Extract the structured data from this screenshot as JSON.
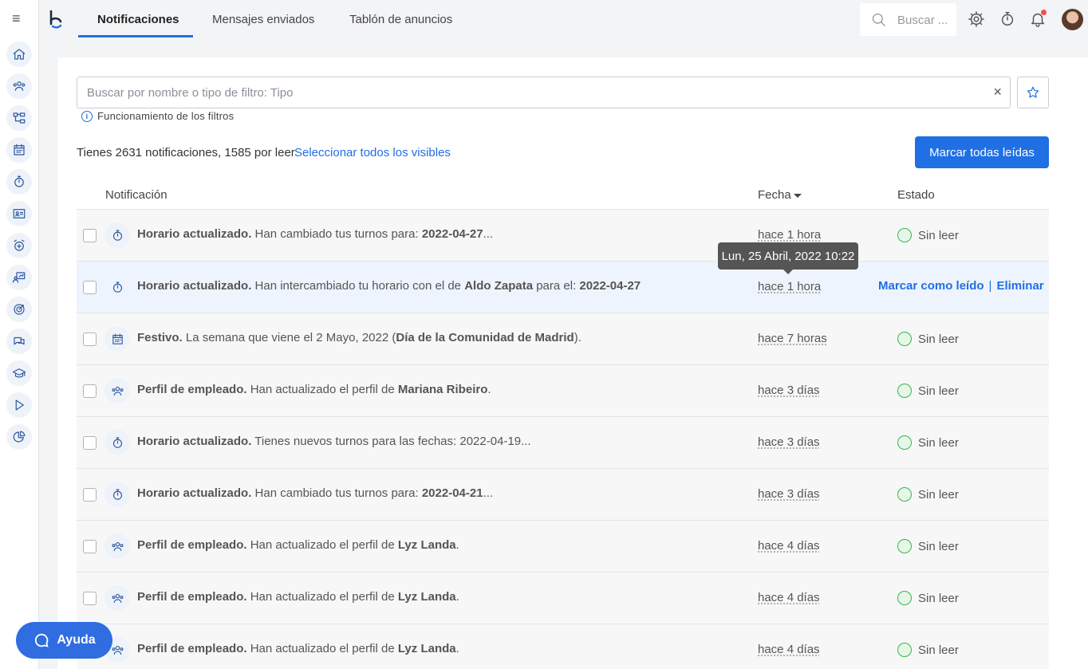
{
  "app": {
    "menu_glyph": "≡"
  },
  "tabs": [
    {
      "label": "Notificaciones",
      "active": true
    },
    {
      "label": "Mensajes enviados"
    },
    {
      "label": "Tablón de anuncios"
    }
  ],
  "top_search": {
    "placeholder": "Buscar ..."
  },
  "filter": {
    "placeholder": "Buscar por nombre o tipo de filtro: Tipo",
    "clear_glyph": "×",
    "help_label": "Funcionamiento de los filtros"
  },
  "summary": {
    "count_text": "Tienes 2631 notificaciones, 1585 por leer",
    "select_all_label": "Seleccionar todos los visibles",
    "mark_all_label": "Marcar todas leídas"
  },
  "table": {
    "headers": {
      "notification": "Notificación",
      "date": "Fecha",
      "status": "Estado"
    },
    "rows": [
      {
        "icon": "stopwatch-icon",
        "title": "Horario actualizado.",
        "body": " Han cambiado tus turnos para: ",
        "bold": "2022-04-27",
        "tail": "...",
        "date": "hace 1 hora",
        "status": "Sin leer"
      },
      {
        "icon": "stopwatch-icon",
        "title": "Horario actualizado.",
        "body": " Han intercambiado tu horario con el de ",
        "bold": "Aldo Zapata",
        "tail": " para el: ",
        "bold2": "2022-04-27",
        "date": "hace 1 hora",
        "status": "",
        "actions": {
          "mark": "Marcar como leído",
          "sep": "|",
          "delete": "Eliminar"
        }
      },
      {
        "icon": "calendar-icon",
        "title": "Festivo.",
        "body": " La semana que viene el 2 Mayo, 2022 (",
        "bold": "Día de la Comunidad de Madrid",
        "tail": ").",
        "date": "hace 7 horas",
        "status": "Sin leer"
      },
      {
        "icon": "users-icon",
        "title": "Perfil de empleado.",
        "body": " Han actualizado el perfil de ",
        "bold": "Mariana Ribeiro",
        "tail": ".",
        "date": "hace 3 días",
        "status": "Sin leer"
      },
      {
        "icon": "stopwatch-icon",
        "title": "Horario actualizado.",
        "body": " Tienes nuevos turnos para las fechas: 2022-04-19...",
        "bold": "",
        "tail": "",
        "date": "hace 3 días",
        "status": "Sin leer"
      },
      {
        "icon": "stopwatch-icon",
        "title": "Horario actualizado.",
        "body": " Han cambiado tus turnos para: ",
        "bold": "2022-04-21",
        "tail": "...",
        "date": "hace 3 días",
        "status": "Sin leer"
      },
      {
        "icon": "users-icon",
        "title": "Perfil de empleado.",
        "body": " Han actualizado el perfil de ",
        "bold": "Lyz Landa",
        "tail": ".",
        "date": "hace 4 días",
        "status": "Sin leer"
      },
      {
        "icon": "users-icon",
        "title": "Perfil de empleado.",
        "body": " Han actualizado el perfil de ",
        "bold": "Lyz Landa",
        "tail": ".",
        "date": "hace 4 días",
        "status": "Sin leer"
      },
      {
        "icon": "users-icon",
        "title": "Perfil de empleado.",
        "body": " Han actualizado el perfil de ",
        "bold": "Lyz Landa",
        "tail": ".",
        "date": "hace 4 días",
        "status": "Sin leer"
      }
    ]
  },
  "tooltip": {
    "text": "Lun, 25 Abril, 2022 10:22"
  },
  "help": {
    "label": "Ayuda"
  },
  "colors": {
    "accent": "#1f6fe5",
    "unread": "#39b54a",
    "alert_dot": "#f04e4e"
  }
}
